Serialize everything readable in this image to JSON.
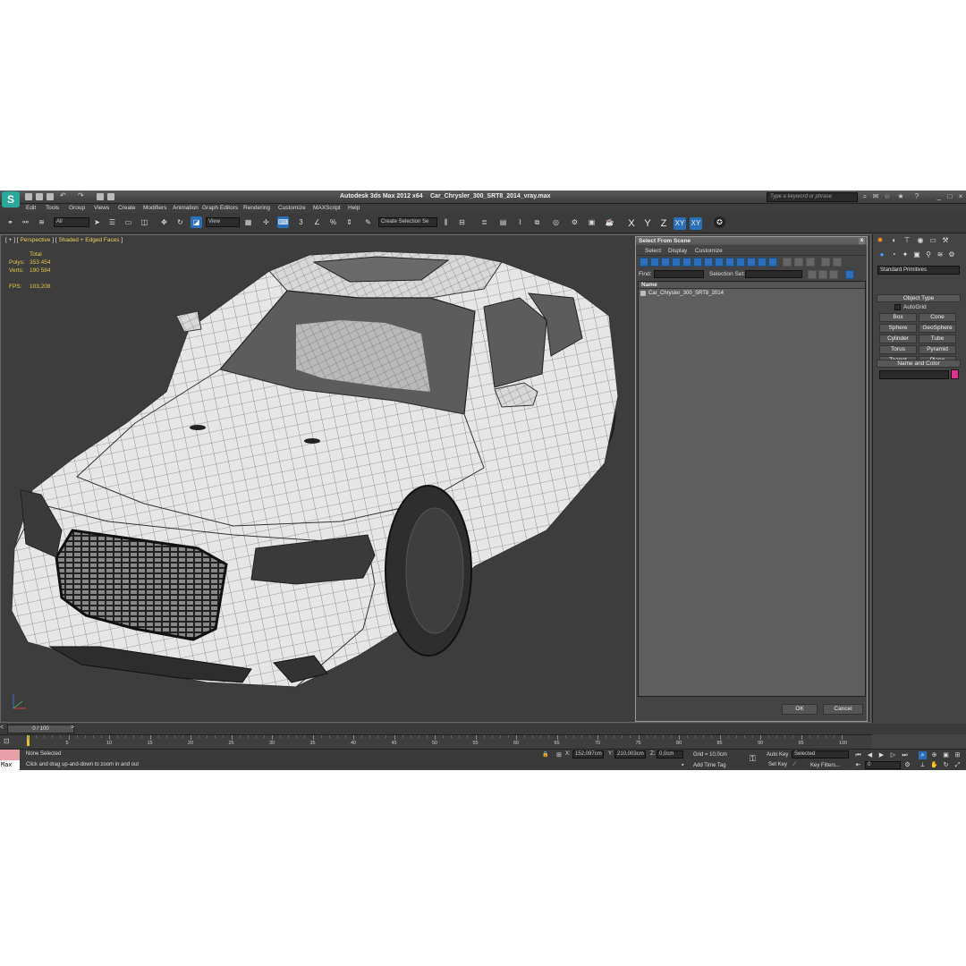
{
  "window": {
    "app_title": "Autodesk 3ds Max  2012 x64",
    "file_name": "Car_Chrysler_300_SRT8_2014_vray.max",
    "logo": "S",
    "search_placeholder": "Type a keyword or phrase"
  },
  "menus": [
    "Edit",
    "Tools",
    "Group",
    "Views",
    "Create",
    "Modifiers",
    "Animation",
    "Graph Editors",
    "Rendering",
    "Customize",
    "MAXScript",
    "Help"
  ],
  "toolbar": {
    "filter_value": "All",
    "ref_coord_value": "View",
    "selection_set_value": "Create Selection Se",
    "axes": [
      "X",
      "Y",
      "Z",
      "XY",
      "XY"
    ]
  },
  "viewport": {
    "label_prefix": "[ + ] [ ",
    "label_view": "Perspective",
    "label_mid": " ] [ ",
    "label_shading": "Shaded + Edged Faces",
    "label_suffix": " ]",
    "stats_header": "Total",
    "polys_label": "Polys:",
    "polys_value": "353 454",
    "verts_label": "Verts:",
    "verts_value": "190 584",
    "fps_label": "FPS:",
    "fps_value": "103,208"
  },
  "dialog": {
    "title": "Select From Scene",
    "close": "x",
    "menu": [
      "Select",
      "Display",
      "Customize"
    ],
    "find_label": "Find:",
    "selection_set_label": "Selection Set:",
    "column_name": "Name",
    "items": [
      "Car_Chrysler_300_SRT8_2014"
    ],
    "ok": "OK",
    "cancel": "Cancel"
  },
  "command_panel": {
    "category": "Standard Primitives",
    "object_type_header": "Object Type",
    "autogrid": "AutoGrid",
    "primitives": [
      "Box",
      "Cone",
      "Sphere",
      "GeoSphere",
      "Cylinder",
      "Tube",
      "Torus",
      "Pyramid",
      "Teapot",
      "Plane"
    ],
    "name_color_header": "Name and Color",
    "swatch_color": "#e2308e"
  },
  "timeline": {
    "slider": "0 / 100",
    "ticks": [
      "0",
      "5",
      "10",
      "15",
      "20",
      "25",
      "30",
      "35",
      "40",
      "45",
      "50",
      "55",
      "60",
      "65",
      "70",
      "75",
      "80",
      "85",
      "90",
      "95",
      "100"
    ]
  },
  "status": {
    "maxscript_label": "Max",
    "selection": "None Selected",
    "prompt": "Click and drag up-and-down to zoom in and out",
    "x_label": "X:",
    "x_value": "152,097cm",
    "y_label": "Y:",
    "y_value": "210,003cm",
    "z_label": "Z:",
    "z_value": "0,0cm",
    "grid": "Grid = 10,0cm",
    "add_time_tag": "Add Time Tag",
    "auto_key": "Auto Key",
    "set_key": "Set Key",
    "key_mode": "Selected",
    "key_filters": "Key Filters...",
    "frame": "0"
  }
}
